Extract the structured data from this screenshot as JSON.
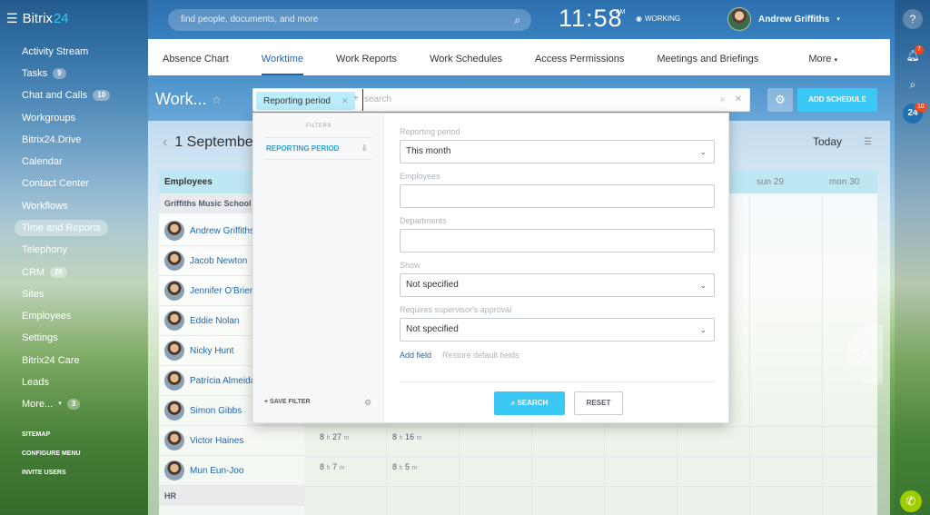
{
  "app": {
    "logo_main": "Bitrix",
    "logo_accent": "24"
  },
  "left_nav": {
    "items": [
      {
        "label": "Activity Stream",
        "count": ""
      },
      {
        "label": "Tasks",
        "count": "9"
      },
      {
        "label": "Chat and Calls",
        "count": "10"
      },
      {
        "label": "Workgroups",
        "count": ""
      },
      {
        "label": "Bitrix24.Drive",
        "count": ""
      },
      {
        "label": "Calendar",
        "count": ""
      },
      {
        "label": "Contact Center",
        "count": ""
      },
      {
        "label": "Workflows",
        "count": ""
      },
      {
        "label": "Time and Reports",
        "count": ""
      },
      {
        "label": "Telephony",
        "count": ""
      },
      {
        "label": "CRM",
        "count": "26"
      },
      {
        "label": "Sites",
        "count": ""
      },
      {
        "label": "Employees",
        "count": ""
      },
      {
        "label": "Settings",
        "count": ""
      },
      {
        "label": "Bitrix24 Care",
        "count": ""
      },
      {
        "label": "Leads",
        "count": ""
      },
      {
        "label": "More...",
        "count": "3"
      }
    ],
    "sitemap": "SITEMAP",
    "configure_menu": "CONFIGURE MENU",
    "invite_users": "INVITE USERS"
  },
  "header": {
    "search_placeholder": "find people, documents, and more",
    "time": "11:58",
    "ampm": "AM",
    "status": "WORKING",
    "user_name": "Andrew Griffiths"
  },
  "right_bar": {
    "notifications_count": "7",
    "b24_label": "24",
    "b24_count": "10"
  },
  "tabs": [
    "Absence Chart",
    "Worktime",
    "Work Reports",
    "Work Schedules",
    "Access Permissions",
    "Meetings and Briefings"
  ],
  "tabs_more": "More",
  "page": {
    "title": "Work...",
    "add_schedule": "ADD SCHEDULE"
  },
  "filter": {
    "chip": "Reporting period",
    "placeholder": "search",
    "filters_heading": "FILTERS",
    "preset": "REPORTING PERIOD",
    "save_filter": "SAVE FILTER",
    "fields": [
      {
        "label": "Reporting period",
        "value": "This month",
        "type": "select"
      },
      {
        "label": "Employees",
        "value": "",
        "type": "text"
      },
      {
        "label": "Departments",
        "value": "",
        "type": "text"
      },
      {
        "label": "Show",
        "value": "Not specified",
        "type": "select"
      },
      {
        "label": "Requires supervisor's approval",
        "value": "Not specified",
        "type": "select"
      }
    ],
    "add_field": "Add field",
    "restore": "Restore default fields",
    "search_button": "SEARCH",
    "reset_button": "RESET"
  },
  "calendar": {
    "date": "1 Septembe",
    "today": "Today",
    "employees_header": "Employees",
    "groups": [
      "Griffiths Music School",
      "HR"
    ],
    "employees": [
      "Andrew Griffiths",
      "Jacob Newton",
      "Jennifer O'Brien",
      "Eddie Nolan",
      "Nicky Hunt",
      "Patrícia Almeida",
      "Simon Gibbs",
      "Victor Haines",
      "Mun Eun-Joo"
    ],
    "days": [
      "sun 29",
      "mon 30"
    ],
    "worktime": [
      {
        "employee": "Victor Haines",
        "day1": {
          "h": "8",
          "m": "27"
        },
        "day2": {
          "h": "8",
          "m": "16"
        }
      },
      {
        "employee": "Mun Eun-Joo",
        "day1": {
          "h": "8",
          "m": "7"
        },
        "day2": {
          "h": "8",
          "m": "5"
        }
      }
    ],
    "hour_unit": "h",
    "minute_unit": "m"
  }
}
